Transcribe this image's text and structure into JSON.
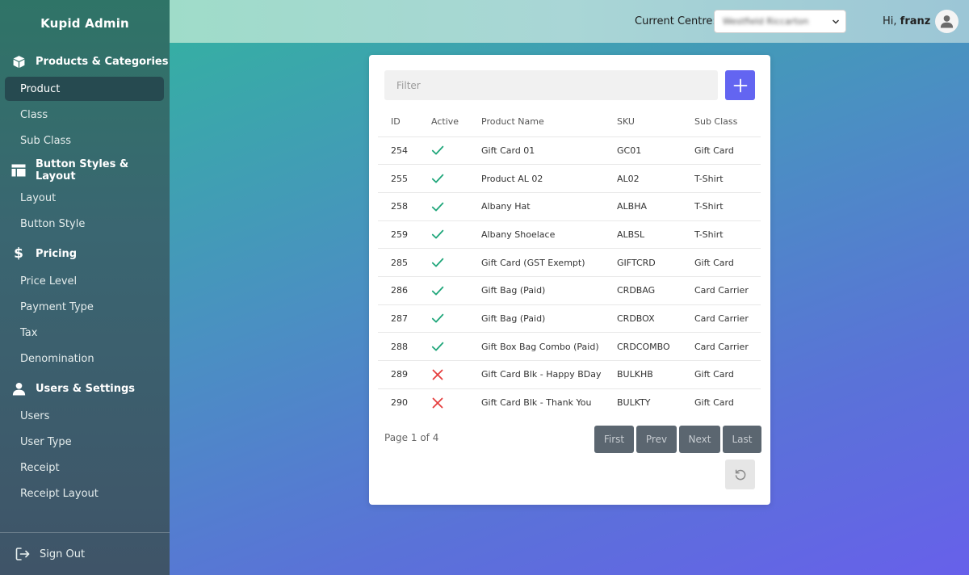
{
  "app": {
    "title": "Kupid Admin"
  },
  "sidebar": {
    "sections": [
      {
        "title": "Products & Categories",
        "icon": "box-icon",
        "items": [
          "Product",
          "Class",
          "Sub Class"
        ]
      },
      {
        "title": "Button Styles & Layout",
        "icon": "layout-icon",
        "items": [
          "Layout",
          "Button Style"
        ]
      },
      {
        "title": "Pricing",
        "icon": "dollar-icon",
        "items": [
          "Price Level",
          "Payment Type",
          "Tax",
          "Denomination"
        ]
      },
      {
        "title": "Users & Settings",
        "icon": "user-icon",
        "items": [
          "Users",
          "User Type",
          "Receipt",
          "Receipt Layout"
        ]
      }
    ],
    "active_item": "Product",
    "sign_out": "Sign Out"
  },
  "header": {
    "centre_label": "Current Centre:",
    "centre_value": "Westfield Riccarton",
    "greeting_prefix": "Hi,",
    "username": "franz"
  },
  "table": {
    "filter_placeholder": "Filter",
    "columns": [
      "ID",
      "Active",
      "Product Name",
      "SKU",
      "Sub Class"
    ],
    "rows": [
      {
        "id": "254",
        "active": true,
        "name": "Gift Card 01",
        "sku": "GC01",
        "subclass": "Gift Card"
      },
      {
        "id": "255",
        "active": true,
        "name": "Product AL 02",
        "sku": "AL02",
        "subclass": "T-Shirt"
      },
      {
        "id": "258",
        "active": true,
        "name": "Albany Hat",
        "sku": "ALBHA",
        "subclass": "T-Shirt"
      },
      {
        "id": "259",
        "active": true,
        "name": "Albany Shoelace",
        "sku": "ALBSL",
        "subclass": "T-Shirt"
      },
      {
        "id": "285",
        "active": true,
        "name": "Gift Card (GST Exempt)",
        "sku": "GIFTCRD",
        "subclass": "Gift Card"
      },
      {
        "id": "286",
        "active": true,
        "name": "Gift Bag (Paid)",
        "sku": "CRDBAG",
        "subclass": "Card Carrier"
      },
      {
        "id": "287",
        "active": true,
        "name": "Gift Bag (Paid)",
        "sku": "CRDBOX",
        "subclass": "Card Carrier"
      },
      {
        "id": "288",
        "active": true,
        "name": "Gift Box Bag Combo (Paid)",
        "sku": "CRDCOMBO",
        "subclass": "Card Carrier"
      },
      {
        "id": "289",
        "active": false,
        "name": "Gift Card Blk - Happy BDay",
        "sku": "BULKHB",
        "subclass": "Gift Card"
      },
      {
        "id": "290",
        "active": false,
        "name": "Gift Card Blk - Thank You",
        "sku": "BULKTY",
        "subclass": "Gift Card"
      }
    ],
    "page_info": "Page 1 of 4",
    "pager": {
      "first": "First",
      "prev": "Prev",
      "next": "Next",
      "last": "Last"
    }
  },
  "colors": {
    "accent": "#6365f1",
    "active_check": "#1fa67a",
    "inactive_cross": "#e53e3e",
    "pager_button": "#5b6670"
  }
}
